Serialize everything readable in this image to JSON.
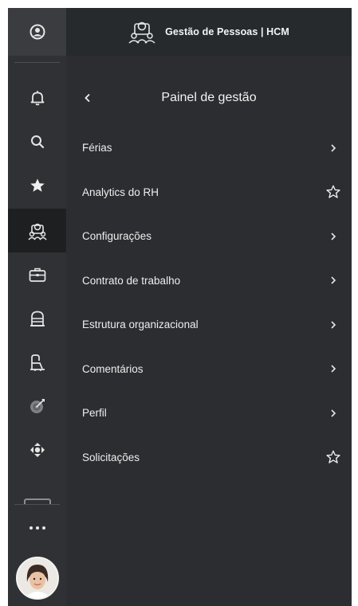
{
  "app": {
    "title": "Gestão de Pessoas | HCM"
  },
  "panel": {
    "title": "Painel de gestão"
  },
  "rail": {
    "items": [
      {
        "icon": "account-circle-icon"
      },
      {
        "icon": "bell-icon"
      },
      {
        "icon": "search-icon"
      },
      {
        "icon": "star-icon"
      },
      {
        "icon": "team-icon"
      },
      {
        "icon": "briefcase-icon"
      },
      {
        "icon": "building-icon"
      },
      {
        "icon": "people-icon"
      },
      {
        "icon": "target-icon"
      },
      {
        "icon": "move-icon"
      },
      {
        "icon": "more-icon"
      }
    ]
  },
  "menu": {
    "items": [
      {
        "label": "Férias",
        "action": "chevron"
      },
      {
        "label": "Analytics do RH",
        "action": "star"
      },
      {
        "label": "Configurações",
        "action": "chevron"
      },
      {
        "label": "Contrato de trabalho",
        "action": "chevron"
      },
      {
        "label": "Estrutura organizacional",
        "action": "chevron"
      },
      {
        "label": "Comentários",
        "action": "chevron"
      },
      {
        "label": "Perfil",
        "action": "chevron"
      },
      {
        "label": "Solicitações",
        "action": "star"
      }
    ]
  },
  "colors": {
    "rail_bg": "#2f3134",
    "panel_bg": "#2b2d30",
    "active_bg": "#1e1f21",
    "text": "#eeeeee",
    "icon": "#e6e6e6"
  }
}
